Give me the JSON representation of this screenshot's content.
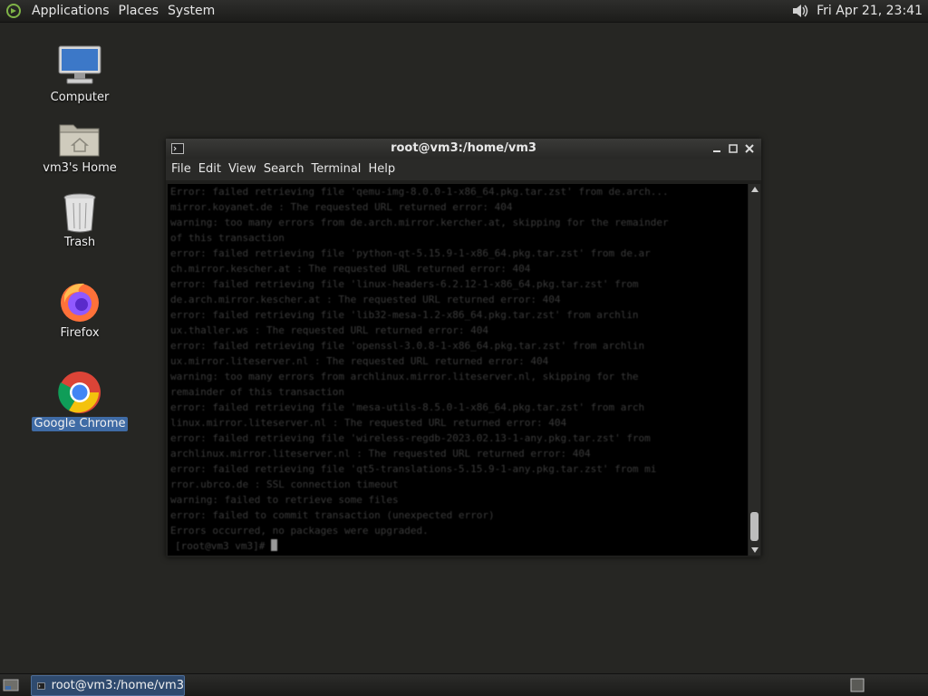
{
  "top_panel": {
    "menus": [
      "Applications",
      "Places",
      "System"
    ],
    "logo_icon": "gnome-foot-icon",
    "volume_icon": "speaker-icon",
    "clock": "Fri Apr 21, 23:41"
  },
  "desktop": {
    "icons": [
      {
        "label": "Computer",
        "icon": "computer-icon"
      },
      {
        "label": "vm3's Home",
        "icon": "home-folder-icon"
      },
      {
        "label": "Trash",
        "icon": "trash-icon"
      },
      {
        "label": "Firefox",
        "icon": "firefox-icon"
      },
      {
        "label": "Google Chrome",
        "icon": "chrome-icon",
        "selected": true
      }
    ]
  },
  "window": {
    "title": "root@vm3:/home/vm3",
    "menus": [
      "File",
      "Edit",
      "View",
      "Search",
      "Terminal",
      "Help"
    ],
    "terminal_lines": [
      "Error: failed retrieving file 'qemu-img-8.0.0-1-x86_64.pkg.tar.zst' from de.arch...",
      "mirror.koyanet.de : The requested URL returned error: 404",
      "warning: too many errors from de.arch.mirror.kercher.at, skipping for the remainder",
      "of this transaction",
      "error: failed retrieving file 'python-qt-5.15.9-1-x86_64.pkg.tar.zst' from de.ar",
      "ch.mirror.kescher.at : The requested URL returned error: 404",
      "error: failed retrieving file 'linux-headers-6.2.12-1-x86_64.pkg.tar.zst' from",
      "de.arch.mirror.kescher.at : The requested URL returned error: 404",
      "error: failed retrieving file 'lib32-mesa-1.2-x86_64.pkg.tar.zst' from archlin",
      "ux.thaller.ws : The requested URL returned error: 404",
      "error: failed retrieving file 'openssl-3.0.8-1-x86_64.pkg.tar.zst' from archlin",
      "ux.mirror.liteserver.nl : The requested URL returned error: 404",
      "warning: too many errors from archlinux.mirror.liteserver.nl, skipping for the",
      "remainder of this transaction",
      "error: failed retrieving file 'mesa-utils-8.5.0-1-x86_64.pkg.tar.zst' from arch",
      "linux.mirror.liteserver.nl : The requested URL returned error: 404",
      "error: failed retrieving file 'wireless-regdb-2023.02.13-1-any.pkg.tar.zst' from",
      "archlinux.mirror.liteserver.nl : The requested URL returned error: 404",
      "error: failed retrieving file 'qt5-translations-5.15.9-1-any.pkg.tar.zst' from mi",
      "rror.ubrco.de : SSL connection timeout",
      "warning: failed to retrieve some files",
      "error: failed to commit transaction (unexpected error)",
      "Errors occurred, no packages were upgraded."
    ],
    "prompt": "[root@vm3 vm3]# "
  },
  "bottom_panel": {
    "task_label": "root@vm3:/home/vm3",
    "show_desktop_icon": "show-desktop-icon",
    "workspace_icon": "workspace-switcher-icon"
  }
}
